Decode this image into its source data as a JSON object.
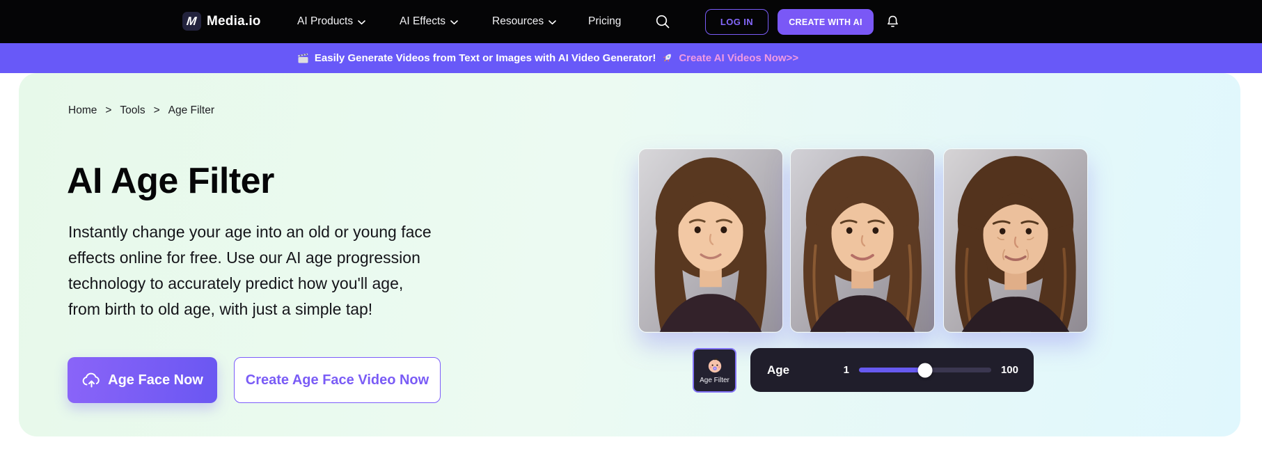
{
  "nav": {
    "logo_mark": "M",
    "logo_text": "Media.io",
    "items": [
      {
        "label": "AI Products",
        "has_dropdown": true
      },
      {
        "label": "AI Effects",
        "has_dropdown": true
      },
      {
        "label": "Resources",
        "has_dropdown": true
      },
      {
        "label": "Pricing",
        "has_dropdown": false
      }
    ],
    "login_label": "LOG IN",
    "cta_label": "CREATE WITH AI",
    "icons": {
      "search": "magnifier",
      "notifications": "bell"
    }
  },
  "banner": {
    "leading_icon": "clapperboard",
    "message": "Easily Generate Videos from Text or Images with AI Video Generator!",
    "trailing_icon": "rocket",
    "link_label": "Create AI Videos Now>>",
    "bg_color": "#6859f8",
    "link_color": "#f09ae3"
  },
  "breadcrumb": {
    "separator": ">",
    "items": [
      "Home",
      "Tools",
      "Age Filter"
    ]
  },
  "hero": {
    "title": "AI Age Filter",
    "description_lines": [
      "Instantly change your age into an old or young face",
      "effects online for free. Use our AI age progression",
      "technology to accurately predict how you'll age,",
      "from birth to old age, with just a simple tap!"
    ],
    "primary_cta": "Age Face Now",
    "primary_cta_icon": "cloud-upload",
    "secondary_cta": "Create Age Face Video Now"
  },
  "preview": {
    "images": [
      {
        "alt": "girl child face"
      },
      {
        "alt": "young woman face"
      },
      {
        "alt": "mature woman face"
      }
    ],
    "filter_card": {
      "label": "Age Filter",
      "icon": "baby-face"
    },
    "age_slider": {
      "label": "Age",
      "min": "1",
      "max": "100",
      "value_percent": 50
    }
  },
  "colors": {
    "accent_purple": "#7a58f6",
    "navbar_bg": "#050506",
    "hero_gradient_start": "#e7f9ea",
    "hero_gradient_end": "#e0f7fd"
  }
}
